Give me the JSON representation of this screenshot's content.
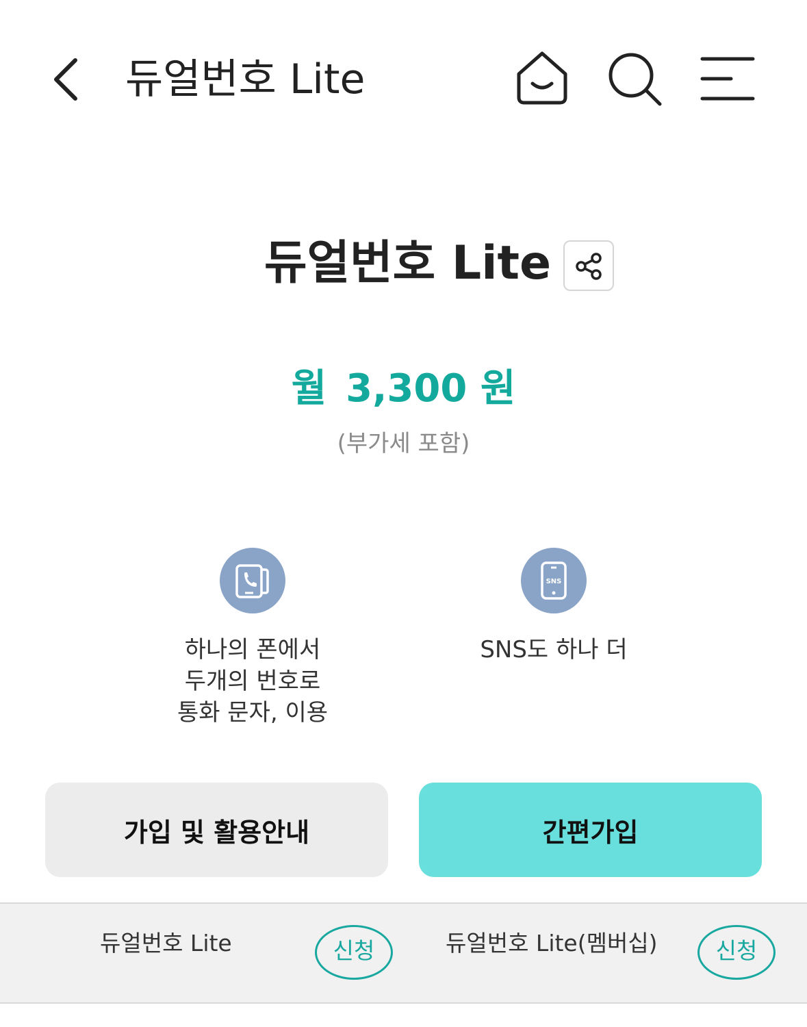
{
  "header": {
    "title": "듀얼번호 Lite",
    "back_icon": "chevron-left-icon",
    "home_icon": "home-icon",
    "search_icon": "search-icon",
    "menu_icon": "menu-icon"
  },
  "product": {
    "title": "듀얼번호 Lite",
    "share_icon": "share-icon"
  },
  "price": {
    "prefix": "월",
    "amount": "3,300",
    "unit": "원",
    "vat_note": "(부가세 포함)",
    "color": "#13a99c"
  },
  "features": [
    {
      "icon": "dual-phone-call-icon",
      "lines": [
        "하나의 폰에서",
        "두개의 번호로",
        "통화 문자, 이용"
      ]
    },
    {
      "icon": "sns-phone-icon",
      "icon_text": "SNS",
      "lines": [
        "SNS도 하나 더"
      ]
    }
  ],
  "buttons": {
    "guide_label": "가입 및 활용안내",
    "join_label": "간편가입",
    "join_color": "#68dfdc"
  },
  "plans": [
    {
      "name": "듀얼번호 Lite",
      "apply_label": "신청"
    },
    {
      "name": "듀얼번호 Lite(멤버십)",
      "apply_label": "신청"
    }
  ]
}
